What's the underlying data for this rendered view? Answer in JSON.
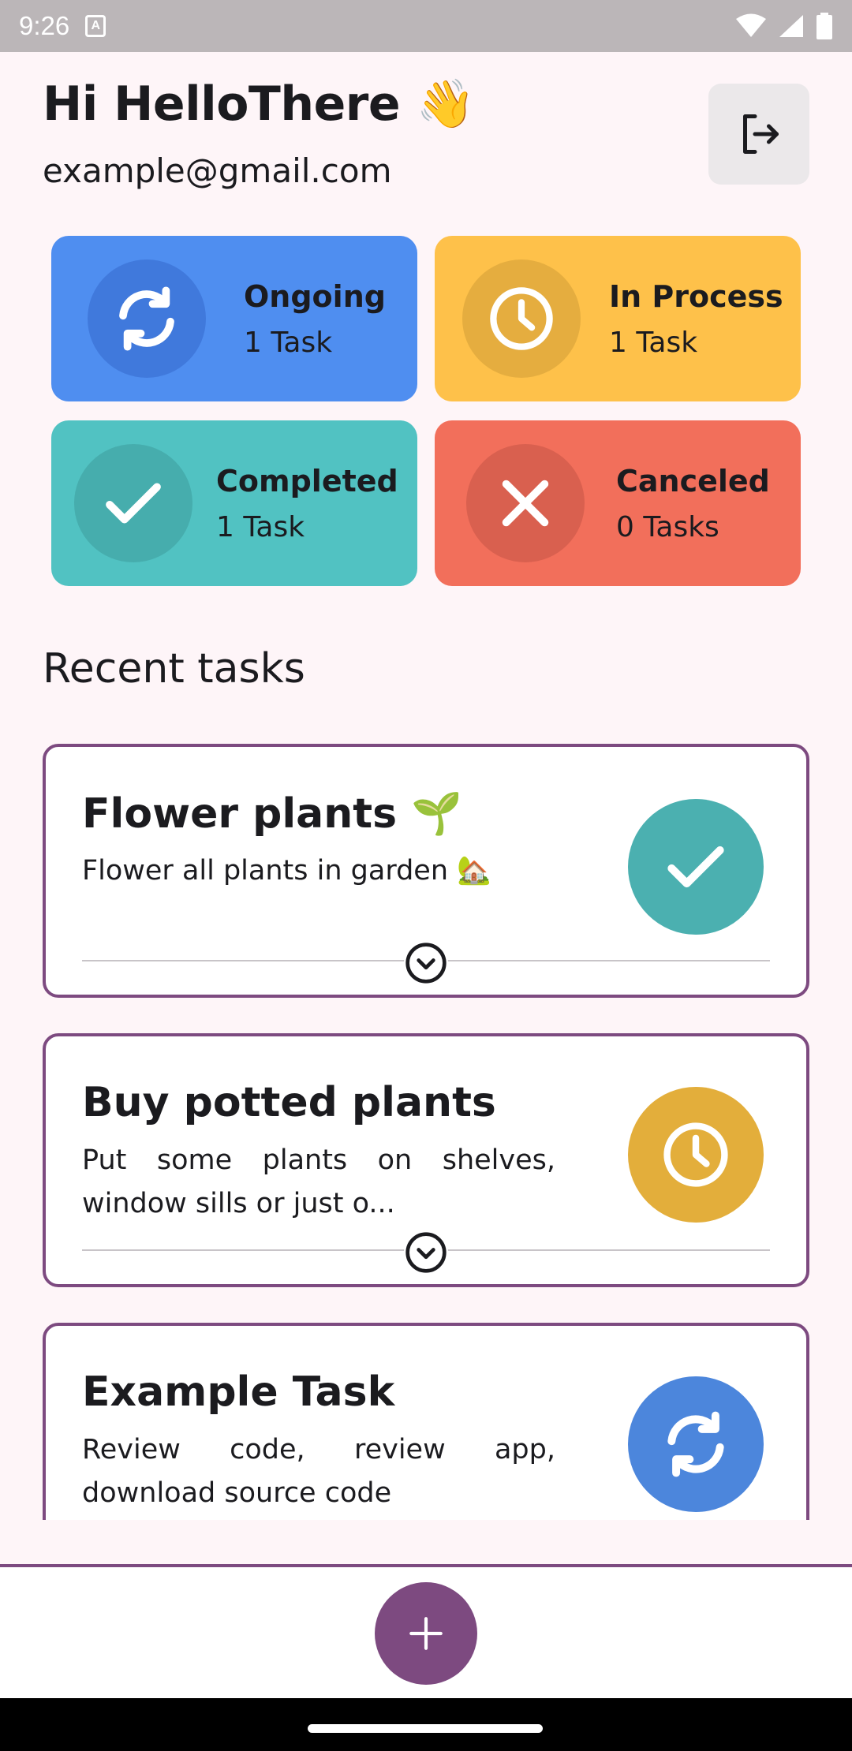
{
  "status_bar": {
    "time": "9:26",
    "notification_glyph": "A"
  },
  "header": {
    "greeting": "Hi HelloThere 👋",
    "email": "example@gmail.com",
    "logout_icon": "logout-icon"
  },
  "summary": [
    {
      "label": "Ongoing",
      "count": "1 Task",
      "icon": "sync-icon",
      "color": "#4f8ef0",
      "circle": "#4079dc"
    },
    {
      "label": "In Process",
      "count": "1 Task",
      "icon": "clock-icon",
      "color": "#fec14a",
      "circle": "#e5ad3f"
    },
    {
      "label": "Completed",
      "count": "1 Task",
      "icon": "check-icon",
      "color": "#51c2c2",
      "circle": "#46adad"
    },
    {
      "label": "Canceled",
      "count": "0 Tasks",
      "icon": "close-icon",
      "color": "#f26f5b",
      "circle": "#d9604f"
    }
  ],
  "recent": {
    "title": "Recent tasks",
    "tasks": [
      {
        "title": "Flower plants 🌱",
        "description": "Flower all plants in garden 🏡",
        "status_icon": "check-icon",
        "status_color": "#4bb0b0"
      },
      {
        "title": "Buy potted plants",
        "description": "Put some plants on shelves, window sills or just o...",
        "status_icon": "clock-icon",
        "status_color": "#e3ae3b"
      },
      {
        "title": "Example Task",
        "description": "Review code, review app, download source code",
        "status_icon": "sync-icon",
        "status_color": "#4c86dc"
      }
    ]
  },
  "fab": {
    "icon": "plus-icon",
    "color": "#7d4a80"
  }
}
